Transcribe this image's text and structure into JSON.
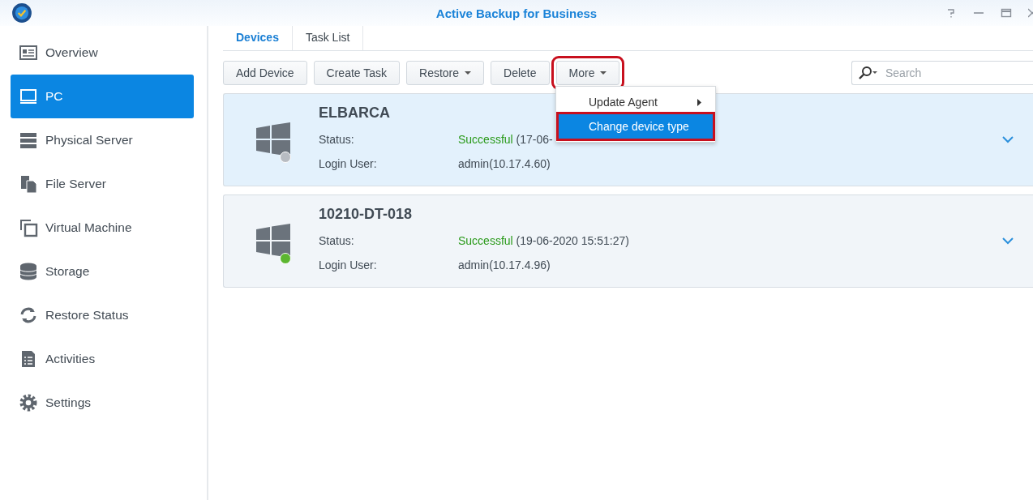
{
  "window": {
    "title": "Active Backup for Business"
  },
  "sidebar": {
    "items": [
      {
        "label": "Overview",
        "selected": false
      },
      {
        "label": "PC",
        "selected": true
      },
      {
        "label": "Physical Server",
        "selected": false
      },
      {
        "label": "File Server",
        "selected": false
      },
      {
        "label": "Virtual Machine",
        "selected": false
      },
      {
        "label": "Storage",
        "selected": false
      },
      {
        "label": "Restore Status",
        "selected": false
      },
      {
        "label": "Activities",
        "selected": false
      },
      {
        "label": "Settings",
        "selected": false
      }
    ]
  },
  "tabs": [
    {
      "label": "Devices",
      "selected": true
    },
    {
      "label": "Task List",
      "selected": false
    }
  ],
  "toolbar": {
    "buttons": [
      {
        "label": "Add Device",
        "dropdown": false,
        "highlighted": false
      },
      {
        "label": "Create Task",
        "dropdown": false,
        "highlighted": false
      },
      {
        "label": "Restore",
        "dropdown": true,
        "highlighted": false
      },
      {
        "label": "Delete",
        "dropdown": false,
        "highlighted": false
      },
      {
        "label": "More",
        "dropdown": true,
        "highlighted": true
      }
    ],
    "search": {
      "placeholder": "Search"
    }
  },
  "menu": {
    "items": [
      {
        "label": "Update Agent",
        "submenu": true,
        "selected": false,
        "highlighted": false
      },
      {
        "label": "Change device type",
        "submenu": false,
        "selected": true,
        "highlighted": true
      }
    ]
  },
  "devices": [
    {
      "name": "ELBARCA",
      "color": "#b8bcc2",
      "selected": true,
      "status_label": "Status:",
      "status": "Successful",
      "status_detail": "(17-06-",
      "user_label": "Login User:",
      "user": "admin(10.17.4.60)"
    },
    {
      "name": "10210-DT-018",
      "color": "#5cb630",
      "selected": false,
      "status_label": "Status:",
      "status": "Successful",
      "status_detail": "(19-06-2020 15:51:27)",
      "user_label": "Login User:",
      "user": "admin(10.17.4.96)"
    }
  ]
}
